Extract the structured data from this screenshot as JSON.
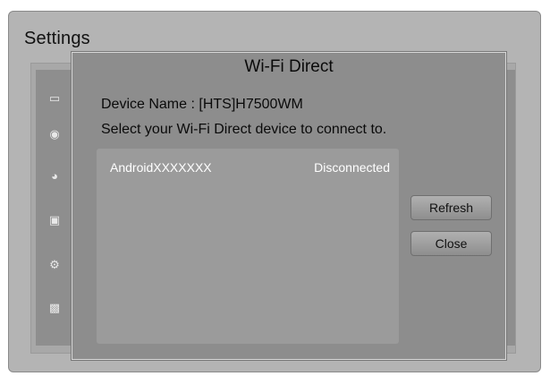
{
  "screen": {
    "title": "Settings"
  },
  "sidebar": {
    "icons": [
      {
        "name": "picture-icon",
        "glyph": "▭"
      },
      {
        "name": "sound-icon",
        "glyph": "◉"
      },
      {
        "name": "network-icon",
        "glyph": "◕"
      },
      {
        "name": "smart-features-icon",
        "glyph": "▣"
      },
      {
        "name": "system-icon",
        "glyph": "⚙"
      },
      {
        "name": "support-icon",
        "glyph": "▩"
      }
    ]
  },
  "popup": {
    "title": "Wi-Fi Direct",
    "device_name_line": "Device Name : [HTS]H7500WM",
    "instruction": "Select your Wi-Fi Direct device to connect to.",
    "devices": [
      {
        "name": "AndroidXXXXXXX",
        "status": "Disconnected"
      }
    ],
    "buttons": {
      "refresh": "Refresh",
      "close": "Close"
    }
  }
}
